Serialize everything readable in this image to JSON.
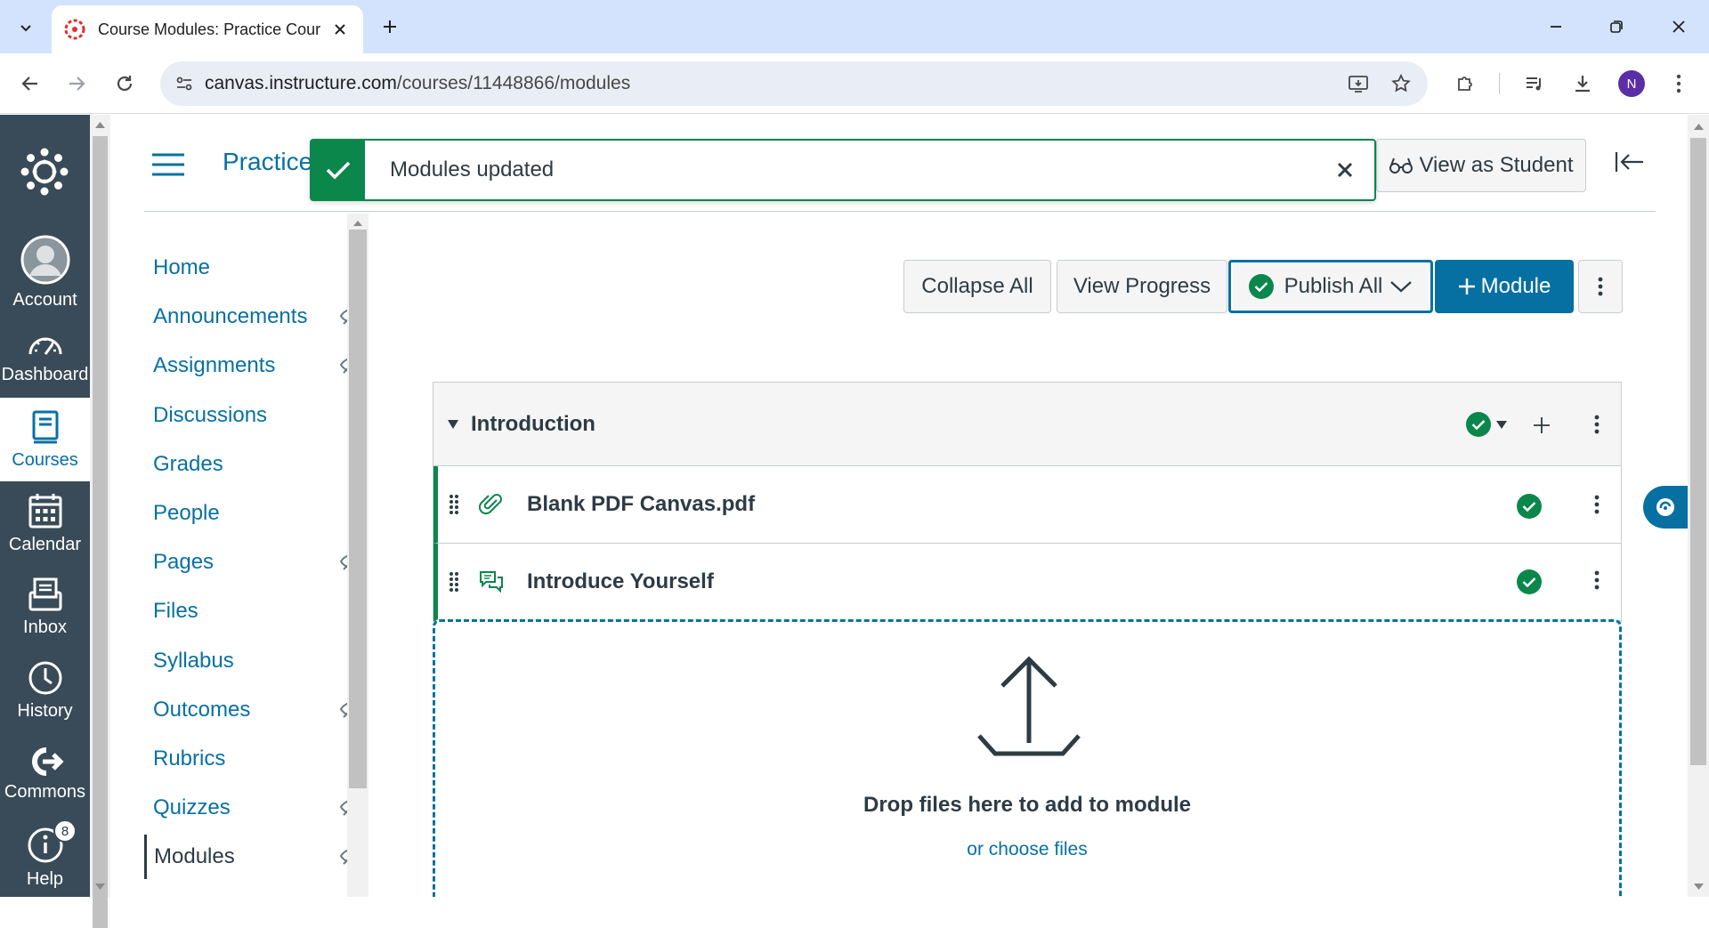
{
  "browser": {
    "tab_title": "Course Modules: Practice Cours",
    "url_host": "canvas.instructure.com",
    "url_path": "/courses/11448866/modules",
    "profile_initial": "N"
  },
  "global_nav": {
    "items": [
      {
        "label": "Account"
      },
      {
        "label": "Dashboard"
      },
      {
        "label": "Courses"
      },
      {
        "label": "Calendar"
      },
      {
        "label": "Inbox"
      },
      {
        "label": "History"
      },
      {
        "label": "Commons"
      },
      {
        "label": "Help",
        "badge": "8"
      }
    ]
  },
  "header": {
    "breadcrumb": "Practice",
    "view_as_student": "View as Student"
  },
  "toast": {
    "message": "Modules updated"
  },
  "course_nav": {
    "items": [
      {
        "label": "Home",
        "hidden": false
      },
      {
        "label": "Announcements",
        "hidden": true
      },
      {
        "label": "Assignments",
        "hidden": true
      },
      {
        "label": "Discussions",
        "hidden": false
      },
      {
        "label": "Grades",
        "hidden": false
      },
      {
        "label": "People",
        "hidden": false
      },
      {
        "label": "Pages",
        "hidden": true
      },
      {
        "label": "Files",
        "hidden": false
      },
      {
        "label": "Syllabus",
        "hidden": false
      },
      {
        "label": "Outcomes",
        "hidden": true
      },
      {
        "label": "Rubrics",
        "hidden": false
      },
      {
        "label": "Quizzes",
        "hidden": true
      },
      {
        "label": "Modules",
        "hidden": true,
        "active": true
      }
    ]
  },
  "toolbar": {
    "collapse_all": "Collapse All",
    "view_progress": "View Progress",
    "publish_all": "Publish All",
    "add_module": "Module"
  },
  "module": {
    "title": "Introduction",
    "items": [
      {
        "name": "Blank PDF Canvas.pdf",
        "type_icon": "attachment-icon",
        "published": true
      },
      {
        "name": "Introduce Yourself",
        "type_icon": "discussion-icon",
        "published": true
      }
    ]
  },
  "dropzone": {
    "title": "Drop files here to add to module",
    "link": "or choose files"
  },
  "colors": {
    "canvas_blue": "#0770a3",
    "nav_dark": "#394b58",
    "success_green": "#0b874b"
  }
}
